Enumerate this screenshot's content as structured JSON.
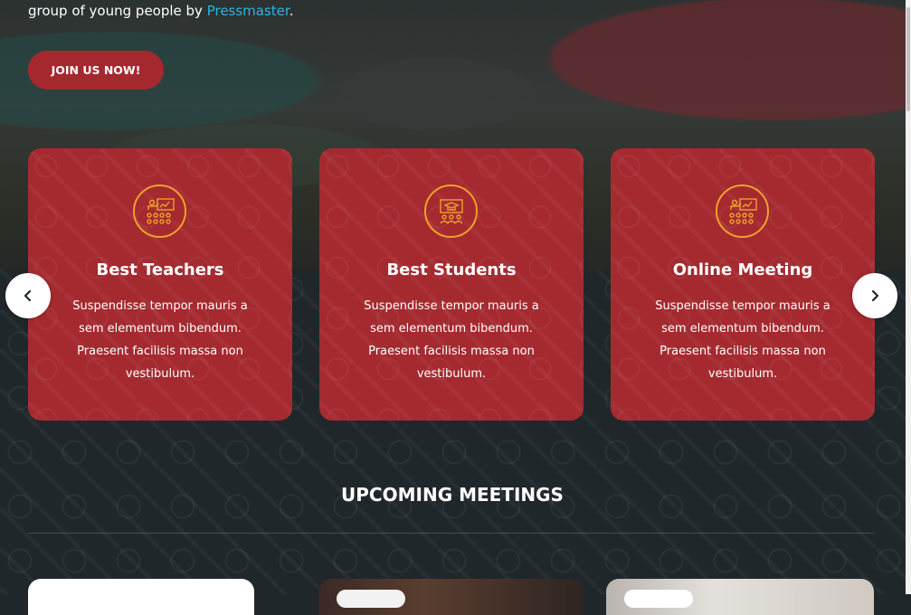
{
  "hero": {
    "intro_prefix": "group of young people by ",
    "intro_link": "Pressmaster",
    "intro_suffix": ".",
    "join_button": "JOIN US NOW!"
  },
  "services": [
    {
      "title": "Best Teachers",
      "icon": "classroom-teacher-icon",
      "text": "Suspendisse tempor mauris a sem elementum bibendum. Praesent facilisis massa non vestibulum."
    },
    {
      "title": "Best Students",
      "icon": "graduation-board-icon",
      "text": "Suspendisse tempor mauris a sem elementum bibendum. Praesent facilisis massa non vestibulum."
    },
    {
      "title": "Online Meeting",
      "icon": "classroom-teacher-icon",
      "text": "Suspendisse tempor mauris a sem elementum bibendum. Praesent facilisis massa non vestibulum."
    }
  ],
  "carousel": {
    "prev_icon": "chevron-left-icon",
    "next_icon": "chevron-right-icon"
  },
  "meetings": {
    "heading": "UPCOMING MEETINGS"
  },
  "colors": {
    "accent_red": "#a42a2f",
    "icon_orange": "#f0a12b",
    "link_blue": "#29b6e5",
    "dark_bg": "#1f272b"
  }
}
